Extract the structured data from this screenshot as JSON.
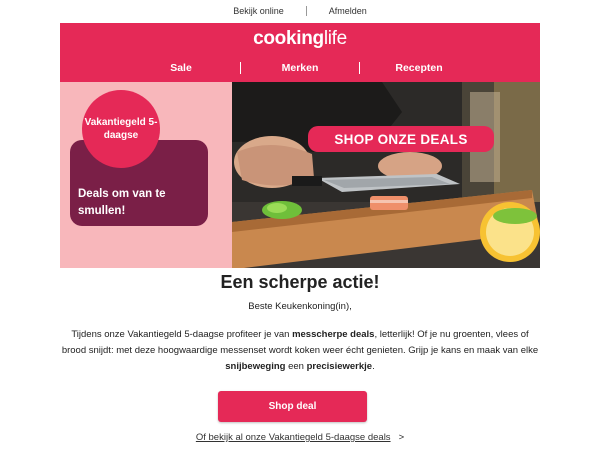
{
  "topbar": {
    "view_online": "Bekijk online",
    "unsubscribe": "Afmelden"
  },
  "header": {
    "logo_bold": "cooking",
    "logo_light": "life",
    "nav": [
      "Sale",
      "Merken",
      "Recepten"
    ]
  },
  "hero": {
    "circle_text": "Vakantiegeld 5-daagse",
    "card_text": "Deals om van te smullen!",
    "badge_text": "SHOP ONZE DEALS"
  },
  "content": {
    "title": "Een scherpe actie!",
    "greeting": "Beste Keukenkoning(in),",
    "body": {
      "p1": "Tijdens onze Vakantiegeld 5-daagse profiteer je van ",
      "b1": "messcherpe deals",
      "p2": ", letterlijk! Of je nu groenten, vlees of brood snijdt: met deze hoogwaardige messenset wordt koken weer écht genieten. Grijp je kans en maak van elke ",
      "b2": "snijbeweging",
      "p3": " een ",
      "b3": "precisiewerkje",
      "p4": "."
    },
    "button": "Shop deal",
    "link": "Of bekijk al onze Vakantiegeld 5-daagse deals",
    "link_chevron": ">"
  },
  "colors": {
    "brand": "#e52957",
    "card": "#7a1f47",
    "hero_bg": "#f8b7bb"
  },
  "icons": {
    "chevron": "chevron-right-icon"
  }
}
